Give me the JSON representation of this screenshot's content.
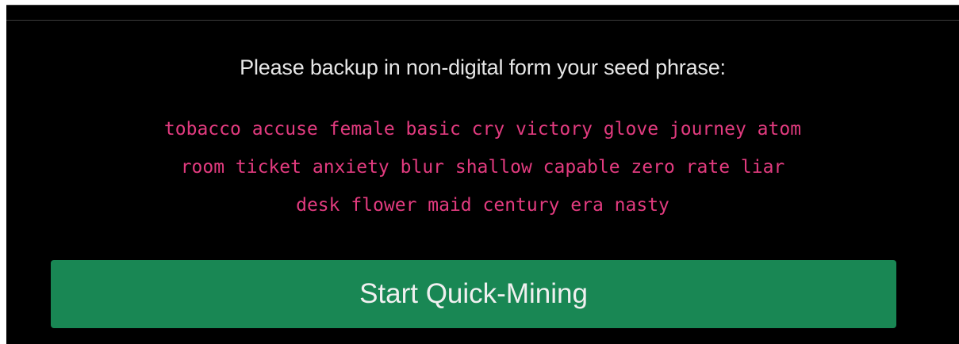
{
  "backup": {
    "instruction": "Please backup in non-digital form your seed phrase:",
    "seed_lines": [
      "tobacco accuse female basic cry victory glove journey atom",
      "room ticket anxiety blur shallow capable zero rate liar",
      "desk flower maid century era nasty"
    ]
  },
  "actions": {
    "start_label": "Start Quick-Mining"
  },
  "colors": {
    "background": "#000000",
    "seed_text": "#e23b7f",
    "button": "#198754"
  }
}
